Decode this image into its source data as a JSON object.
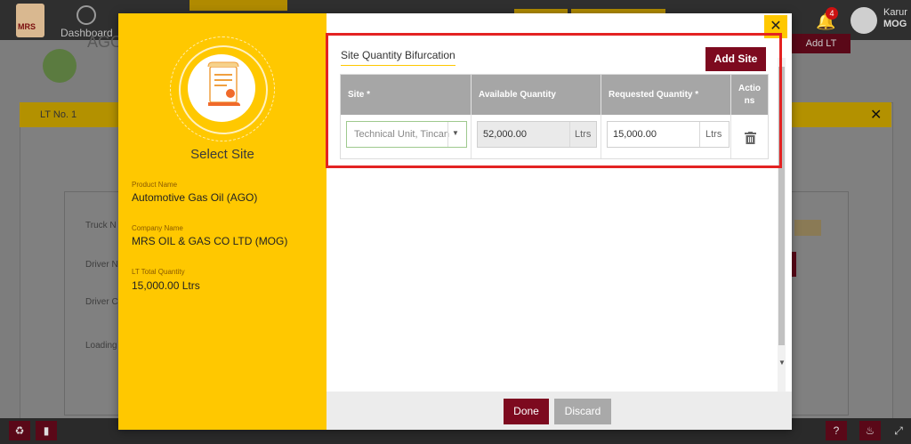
{
  "app": {
    "logo_text": "MRS",
    "nav_dashboard": "Dashboard",
    "notification_count": "4",
    "user_name": "Karur",
    "user_org": "MOG",
    "bell_glyph": "🔔"
  },
  "background": {
    "page_title": "AGO",
    "add_lt_label": "Add LT",
    "lt_header": "LT No. 1",
    "close_glyph": "✕",
    "labels": [
      "Truck N",
      "Driver N",
      "Driver C",
      "Loading"
    ]
  },
  "modal": {
    "close_glyph": "✕",
    "side": {
      "title": "Select Site",
      "product_label": "Product Name",
      "product_value": "Automotive Gas Oil (AGO)",
      "company_label": "Company Name",
      "company_value": "MRS OIL & GAS CO LTD (MOG)",
      "total_label": "LT Total Quantity",
      "total_value": "15,000.00 Ltrs"
    },
    "section_title": "Site Quantity Bifurcation",
    "add_site_label": "Add Site",
    "columns": {
      "site": "Site *",
      "available": "Available Quantity",
      "requested": "Requested Quantity *",
      "actions": "Actio\nns"
    },
    "row": {
      "site_value": "Technical Unit, Tincan",
      "available_value": "52,000.00",
      "available_unit": "Ltrs",
      "requested_value": "15,000.00",
      "requested_unit": "Ltrs"
    },
    "done_label": "Done",
    "discard_label": "Discard"
  },
  "icons": {
    "document": "document-certificate-icon",
    "trash": "trash-icon",
    "caret": "chevron-down-icon",
    "bell": "bell-icon",
    "recycle": "recycle-icon",
    "bookmark": "bookmark-icon",
    "help": "help-icon",
    "fire": "fire-icon",
    "expand": "expand-icon"
  },
  "colors": {
    "accent_yellow": "#ffc800",
    "brand_maroon": "#7d0a1f",
    "header_grey": "#a6a6a6",
    "highlight_red": "#e32222"
  }
}
